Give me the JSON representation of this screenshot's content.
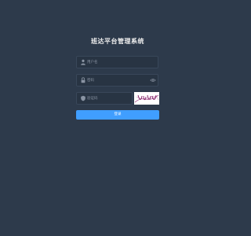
{
  "app": {
    "title": "班达平台管理系统"
  },
  "form": {
    "username": {
      "placeholder": "用户名",
      "value": "",
      "icon": "user-icon"
    },
    "password": {
      "placeholder": "密码",
      "value": "",
      "icon": "lock-icon",
      "toggle_icon": "eye-icon"
    },
    "captcha": {
      "placeholder": "验证码",
      "value": "",
      "icon": "shield-icon"
    },
    "login_label": "登录"
  },
  "colors": {
    "background": "#2d3a4b",
    "input_background": "#283443",
    "accent": "#409eff",
    "title": "#eeeeee",
    "captcha_ink": "#8b1a6b"
  }
}
